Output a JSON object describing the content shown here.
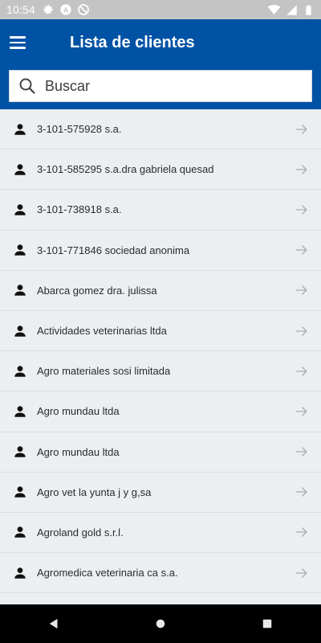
{
  "status_bar": {
    "time": "10:54",
    "left_icons": [
      "gear-icon",
      "app-a-icon",
      "no-disturb-icon"
    ],
    "right_icons": [
      "wifi-icon",
      "signal-icon",
      "battery-icon"
    ]
  },
  "app_bar": {
    "title": "Lista de clientes",
    "menu_icon": "hamburger-menu-icon"
  },
  "search": {
    "placeholder": "Buscar",
    "value": ""
  },
  "clients": [
    "3-101-575928 s.a.",
    "3-101-585295 s.a.dra gabriela quesad",
    "3-101-738918 s.a.",
    "3-101-771846 sociedad anonima",
    "Abarca gomez dra. julissa",
    "Actividades veterinarias ltda",
    "Agro materiales sosi limitada",
    "Agro mundau ltda",
    "Agro mundau ltda",
    "Agro vet la yunta j y g,sa",
    "Agroland gold s.r.l.",
    "Agromedica veterinaria ca s.a."
  ],
  "colors": {
    "app_bar": "#0052a5",
    "status_bar": "#c4c4c4",
    "list_background": "#eceff1",
    "nav_bar": "#000000"
  },
  "nav_bar": {
    "icons": [
      "back-icon",
      "home-icon",
      "recents-icon"
    ]
  }
}
